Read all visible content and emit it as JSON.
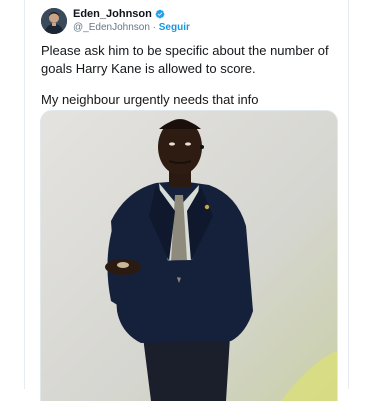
{
  "tweet": {
    "author": {
      "name": "Eden_Johnson",
      "handle": "@_EdenJohnson",
      "separator": "·",
      "follow_label": "Seguir",
      "verified": true,
      "avatar_icon": "profile-avatar"
    },
    "text": {
      "paragraph_1": "Please ask him to be specific about the number of goals Harry Kane is allowed to score.",
      "paragraph_2": "My neighbour urgently needs that info"
    },
    "media": {
      "type": "photo",
      "content_icon": "man-in-suit-photo"
    }
  },
  "colors": {
    "link_blue": "#1b95e0",
    "verified_blue": "#1da1f2",
    "secondary_text": "#657786",
    "primary_text": "#14171a",
    "border": "#e6ecf0"
  }
}
